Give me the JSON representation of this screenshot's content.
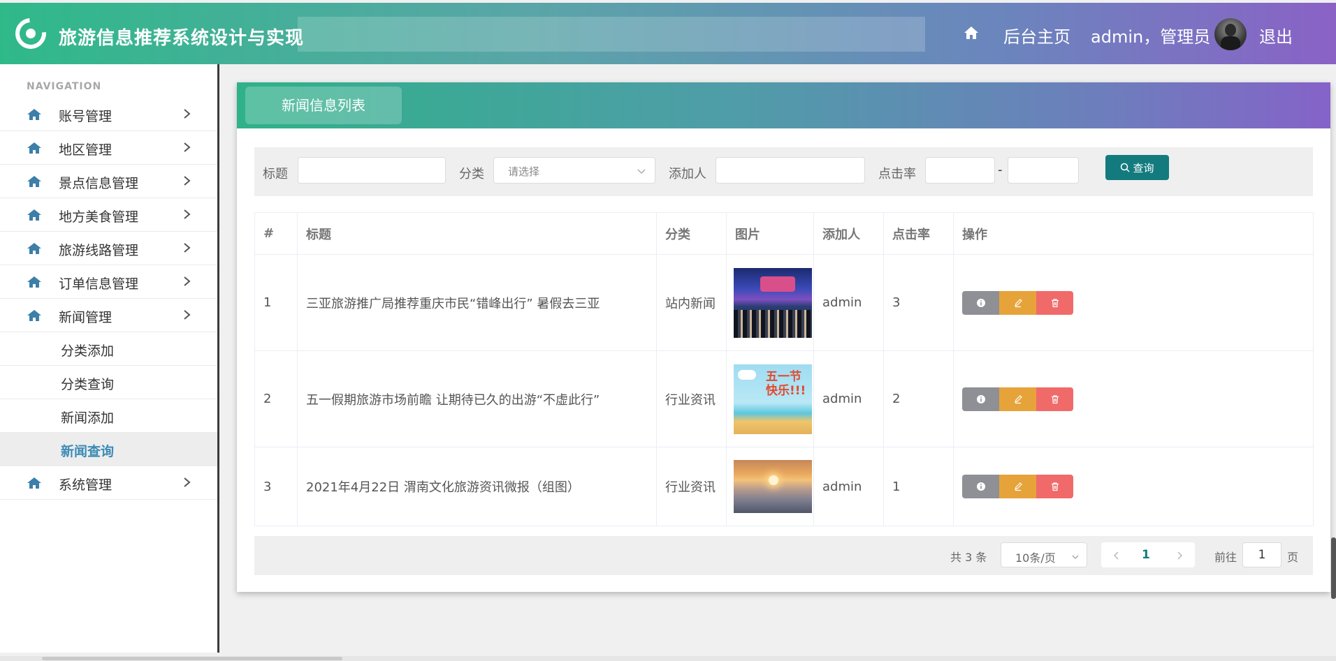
{
  "header": {
    "app_title": "旅游信息推荐系统设计与实现",
    "home_label": "后台主页",
    "user_label": "admin，管理员",
    "logout_label": "退出"
  },
  "sidebar": {
    "caption": "NAVIGATION",
    "items": [
      {
        "label": "账号管理"
      },
      {
        "label": "地区管理"
      },
      {
        "label": "景点信息管理"
      },
      {
        "label": "地方美食管理"
      },
      {
        "label": "旅游线路管理"
      },
      {
        "label": "订单信息管理"
      },
      {
        "label": "新闻管理"
      },
      {
        "label": "系统管理"
      }
    ],
    "subitems": [
      {
        "label": "分类添加"
      },
      {
        "label": "分类查询"
      },
      {
        "label": "新闻添加"
      },
      {
        "label": "新闻查询"
      }
    ]
  },
  "card": {
    "tab_label": "新闻信息列表"
  },
  "search": {
    "title_label": "标题",
    "title_value": "",
    "category_label": "分类",
    "category_value": "请选择",
    "adder_label": "添加人",
    "adder_value": "",
    "clicks_label": "点击率",
    "clicks_min": "",
    "clicks_max": "",
    "range_sep": "-",
    "button_label": "查询"
  },
  "table": {
    "columns": [
      "#",
      "标题",
      "分类",
      "图片",
      "添加人",
      "点击率",
      "操作"
    ],
    "rows": [
      {
        "no": "1",
        "title": "三亚旅游推广局推荐重庆市民“错峰出行” 暑假去三亚",
        "category": "站内新闻",
        "adder": "admin",
        "clicks": "3"
      },
      {
        "no": "2",
        "title": "五一假期旅游市场前瞻 让期待已久的出游“不虚此行”",
        "category": "行业资讯",
        "adder": "admin",
        "clicks": "2"
      },
      {
        "no": "3",
        "title": "2021年4月22日 渭南文化旅游资讯微报（组图）",
        "category": "行业资讯",
        "adder": "admin",
        "clicks": "1"
      }
    ]
  },
  "pagination": {
    "total": "共 3 条",
    "page_size": "10条/页",
    "current": "1",
    "goto_label": "前往",
    "goto_value": "1",
    "page_suffix": "页"
  },
  "colors": {
    "header_start": "#2fb989",
    "header_end": "#8a62c6",
    "primary": "#137b7e",
    "info_btn": "#8f9095",
    "edit_btn": "#e6a33a",
    "delete_btn": "#f06a6a",
    "active_nav": "#3c8bb5"
  },
  "icons": {
    "logo": "refresh-ring-icon",
    "home": "home-icon",
    "chevron": "chevron-right-icon",
    "search": "search-icon",
    "info": "info-icon",
    "edit": "pencil-icon",
    "delete": "trash-icon"
  }
}
